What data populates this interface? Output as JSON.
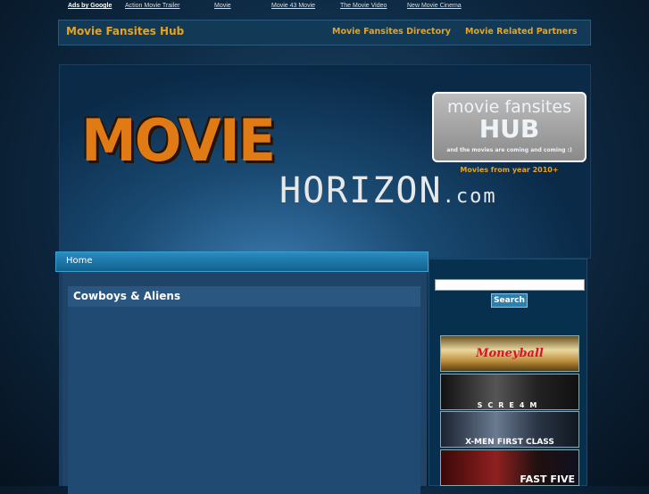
{
  "ads": {
    "label": "Ads by Google",
    "links": [
      "Action Movie Trailer",
      "Movie",
      "Movie 43 Movie",
      "The Movie Video",
      "New Movie Cinema"
    ]
  },
  "nav": {
    "site_title": "Movie Fansites Hub",
    "items": [
      "Movie Fansites Directory",
      "Movie Related Partners"
    ]
  },
  "header": {
    "logo_top": "MOVIE",
    "logo_bottom": "HORIZON",
    "logo_tld": ".com",
    "hub_line1": "movie fansites",
    "hub_line2": "HUB",
    "hub_line3": "and the movies are coming and coming :)",
    "hub_sub": "Movies from year 2010+"
  },
  "breadcrumb": {
    "home": "Home"
  },
  "post": {
    "title": "Cowboys & Aliens"
  },
  "sidebar": {
    "search_value": "",
    "search_button": "Search",
    "banners": [
      "Moneyball",
      "SCRE4M",
      "X-MEN FIRST CLASS",
      "FAST FIVE"
    ]
  }
}
